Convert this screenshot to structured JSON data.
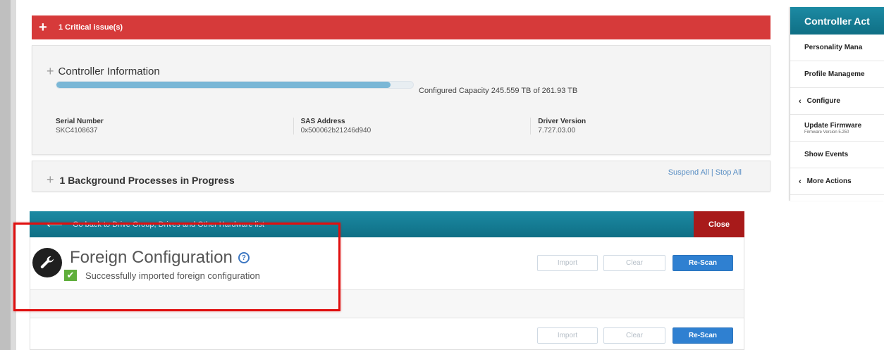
{
  "critical_bar": {
    "icon": "plus-icon",
    "text": "1 Critical issue(s)",
    "color": "#d63a3a"
  },
  "controller_info": {
    "title": "Controller Information",
    "capacity_text": "Configured Capacity 245.559 TB of 261.93 TB",
    "capacity_fraction": 0.9375,
    "fields": [
      {
        "label": "Serial Number",
        "value": "SKC4108637"
      },
      {
        "label": "SAS Address",
        "value": "0x500062b21246d940"
      },
      {
        "label": "Driver Version",
        "value": "7.727.03.00"
      }
    ]
  },
  "background_processes": {
    "title": "1 Background Processes in Progress",
    "suspend_all": "Suspend All",
    "separator": "|",
    "stop_all": "Stop All"
  },
  "nav_bar": {
    "back_text": "Go back to Drive Group, Drives and Other Hardware list",
    "close_label": "Close",
    "accent": "#0f6f85"
  },
  "foreign_config": {
    "title": "Foreign Configuration",
    "help_glyph": "?",
    "status_text": "Successfully imported foreign configuration",
    "buttons": {
      "import": "Import",
      "clear": "Clear",
      "rescan": "Re-Scan"
    }
  },
  "sidebar": {
    "header": "Controller Act",
    "items": [
      {
        "label": "Personality Mana"
      },
      {
        "label": "Profile Manageme"
      },
      {
        "label": "Configure",
        "caret": "‹"
      },
      {
        "label": "Update Firmware",
        "sub": "Firmware Version 5.250"
      },
      {
        "label": "Show Events"
      },
      {
        "label": "More Actions",
        "caret": "‹"
      }
    ]
  }
}
